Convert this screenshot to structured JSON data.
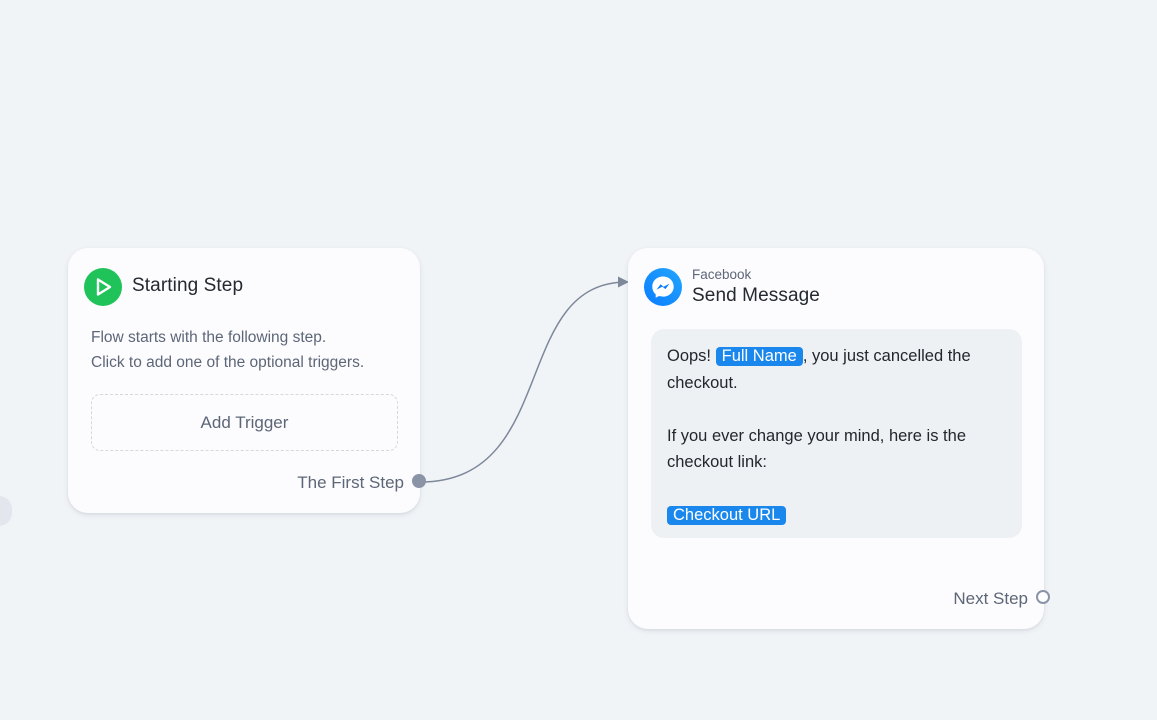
{
  "start_node": {
    "title": "Starting Step",
    "description_line1": "Flow starts with the following step.",
    "description_line2": "Click to add one of the optional triggers.",
    "add_trigger_label": "Add Trigger",
    "output_label": "The First Step",
    "icon": "play-icon",
    "icon_color": "#1fc35a"
  },
  "message_node": {
    "platform": "Facebook",
    "title": "Send Message",
    "icon": "messenger-icon",
    "message": {
      "intro": "Oops!",
      "name_tag": "Full Name",
      "after_name": ", you just cancelled the checkout.",
      "second_paragraph": "If you ever change your mind, here is the checkout link:",
      "url_tag": "Checkout URL"
    },
    "output_label": "Next Step",
    "tag_color": "#1a87ec"
  }
}
